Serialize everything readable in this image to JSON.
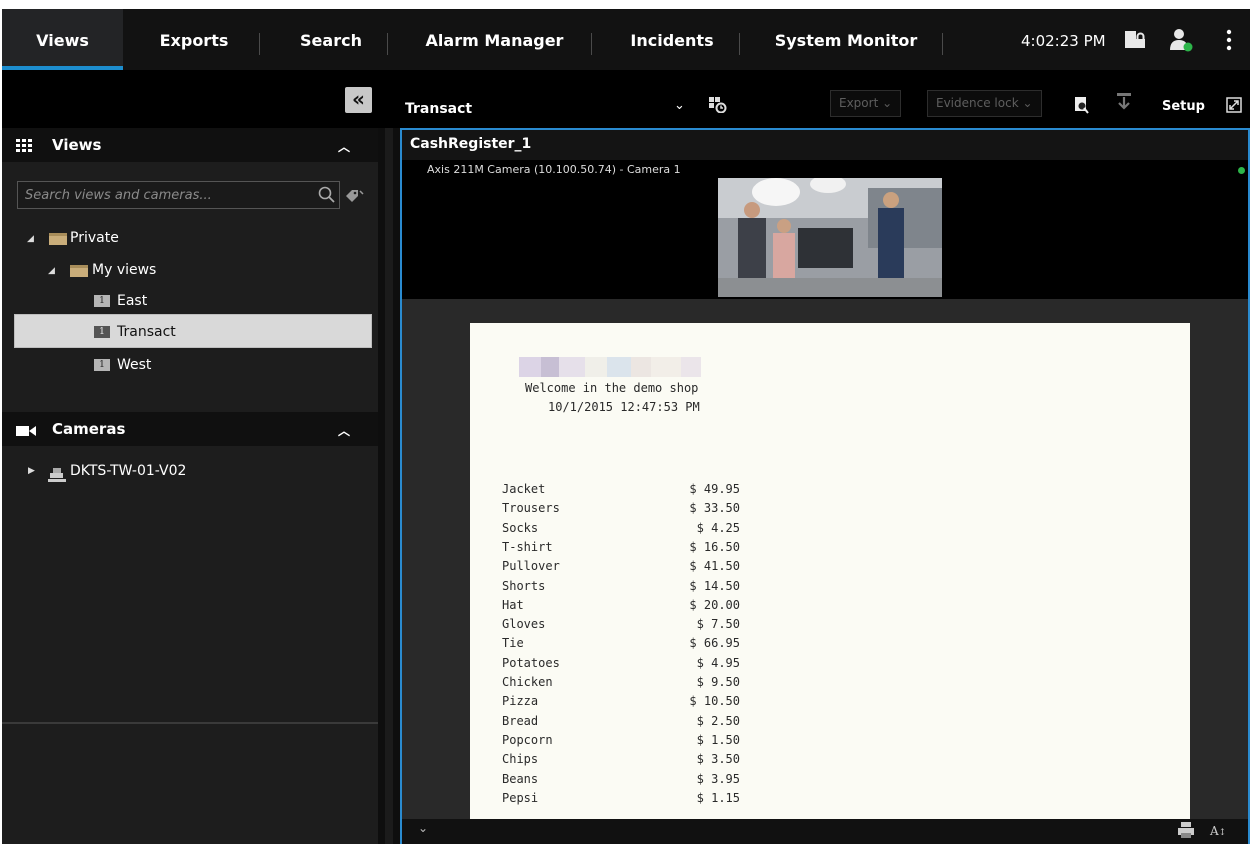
{
  "tabs": [
    {
      "label": "Views"
    },
    {
      "label": "Exports"
    },
    {
      "label": "Search"
    },
    {
      "label": "Alarm Manager"
    },
    {
      "label": "Incidents"
    },
    {
      "label": "System Monitor"
    }
  ],
  "header": {
    "time": "4:02:23 PM"
  },
  "toolbar": {
    "collapse_glyph": "«",
    "view_name": "Transact",
    "export_label": "Export",
    "evidence_lock_label": "Evidence lock",
    "setup_label": "Setup"
  },
  "views_panel": {
    "title": "Views",
    "search_placeholder": "Search views and cameras...",
    "tree": {
      "private": "Private",
      "my_views": "My views",
      "views": [
        {
          "badge": "1",
          "label": "East"
        },
        {
          "badge": "1",
          "label": "Transact"
        },
        {
          "badge": "1",
          "label": "West"
        }
      ]
    }
  },
  "cameras_panel": {
    "title": "Cameras",
    "server": "DKTS-TW-01-V02"
  },
  "view_item": {
    "title": "CashRegister_1",
    "camera_label": "Axis 211M Camera (10.100.50.74) - Camera 1",
    "status_color": "#2db54a"
  },
  "receipt": {
    "welcome": "Welcome in the demo shop",
    "datetime": "10/1/2015 12:47:53 PM",
    "items": [
      {
        "name": "Jacket",
        "price": "$ 49.95"
      },
      {
        "name": "Trousers",
        "price": "$ 33.50"
      },
      {
        "name": "Socks",
        "price": "$ 4.25"
      },
      {
        "name": "T-shirt",
        "price": "$ 16.50"
      },
      {
        "name": "Pullover",
        "price": "$ 41.50"
      },
      {
        "name": "Shorts",
        "price": "$ 14.50"
      },
      {
        "name": "Hat",
        "price": "$ 20.00"
      },
      {
        "name": "Gloves",
        "price": "$ 7.50"
      },
      {
        "name": "Tie",
        "price": "$ 66.95"
      },
      {
        "name": "Potatoes",
        "price": "$ 4.95"
      },
      {
        "name": "Chicken",
        "price": "$ 9.50"
      },
      {
        "name": "Pizza",
        "price": "$ 10.50"
      },
      {
        "name": "Bread",
        "price": "$ 2.50"
      },
      {
        "name": "Popcorn",
        "price": "$ 1.50"
      },
      {
        "name": "Chips",
        "price": "$ 3.50"
      },
      {
        "name": "Beans",
        "price": "$ 3.95"
      },
      {
        "name": "Pepsi",
        "price": "$ 1.15"
      }
    ]
  },
  "colors": {
    "accent": "#1d8ecf",
    "selected_row": "#d9d9d9",
    "receipt_bg": "#fbfbf4"
  }
}
